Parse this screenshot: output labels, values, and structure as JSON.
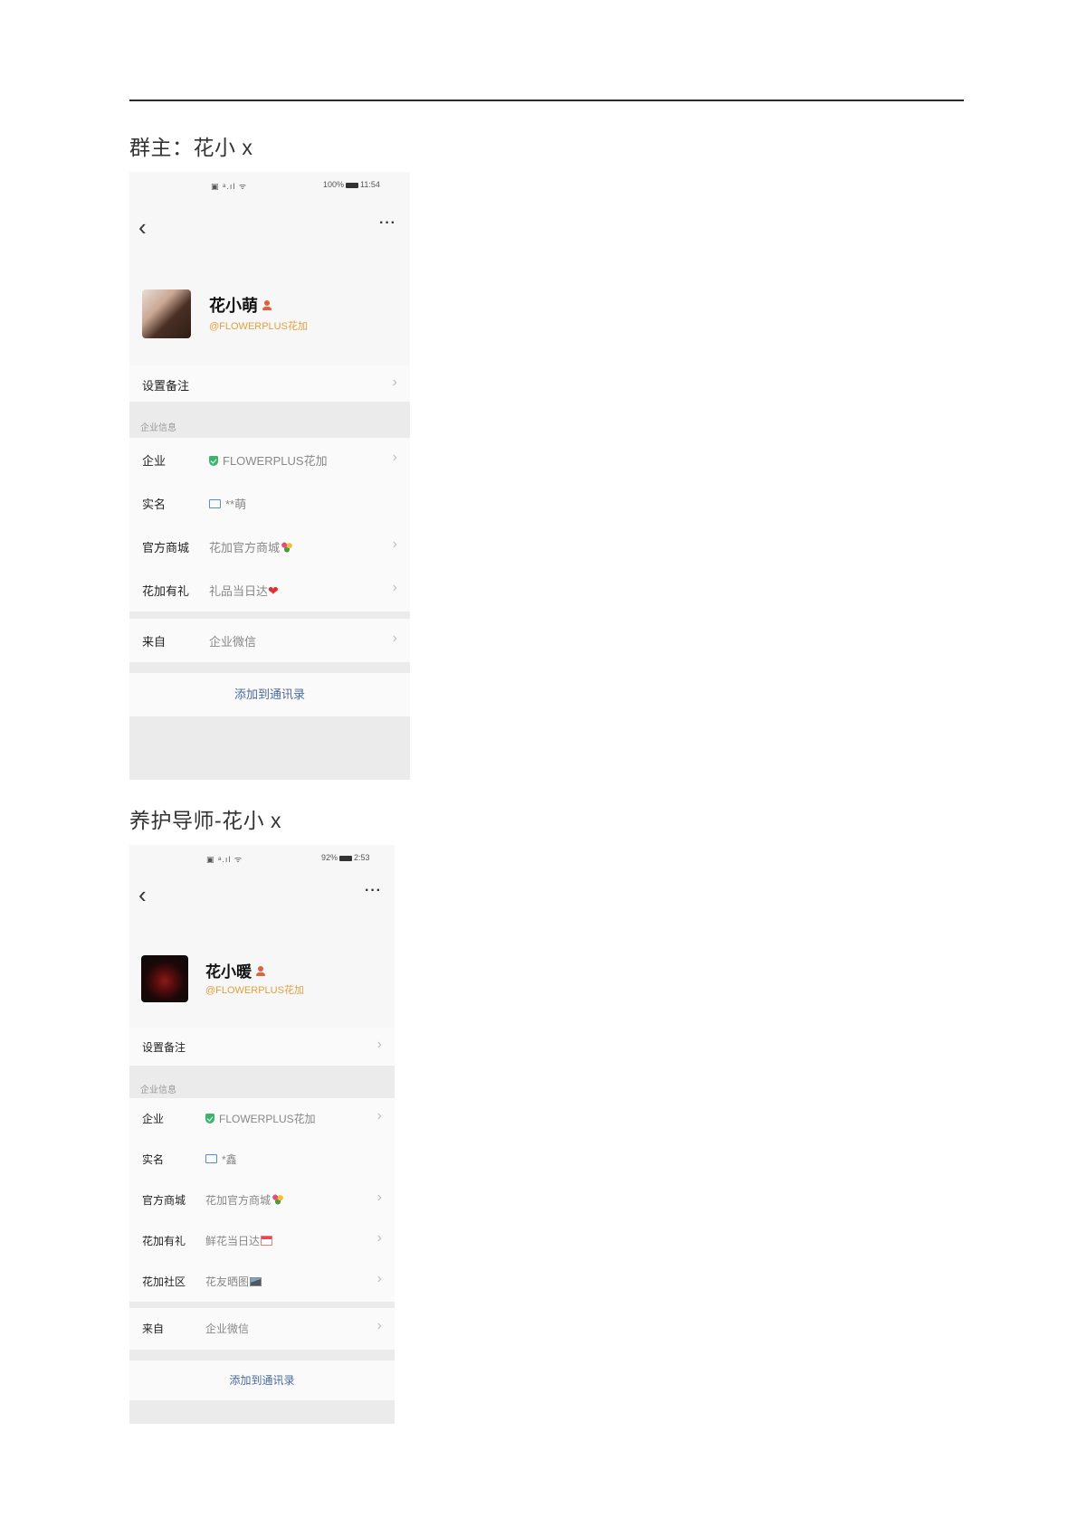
{
  "section1": {
    "title": "群主：花小 x",
    "phone": {
      "status_left": "▣ ᵃ.ıl ᯤ",
      "status_right": "100%",
      "status_time": "11:54",
      "back_icon": "chevron-left",
      "more_icon": "more-horizontal",
      "name": "花小萌",
      "handle": "@FLOWERPLUS花加",
      "set_note_label": "设置备注",
      "group_label": "企业信息",
      "rows": [
        {
          "label": "企业",
          "value": "FLOWERPLUS花加",
          "icon": "verified-shield"
        },
        {
          "label": "实名",
          "value": "**萌",
          "icon": "id-card"
        },
        {
          "label": "官方商城",
          "value": "花加官方商城",
          "icon": "bouquet-emoji"
        },
        {
          "label": "花加有礼",
          "value": "礼品当日达",
          "icon": "heart-emoji"
        }
      ],
      "from_label": "来自",
      "from_value": "企业微信",
      "add_button": "添加到通讯录"
    }
  },
  "section2": {
    "title": "养护导师-花小 x",
    "phone": {
      "status_left": "▣ ᵃ.ıl ᯤ",
      "status_right": "92%",
      "status_time": "2:53",
      "back_icon": "chevron-left",
      "more_icon": "more-horizontal",
      "name": "花小暖",
      "handle": "@FLOWERPLUS花加",
      "set_note_label": "设置备注",
      "group_label": "企业信息",
      "rows": [
        {
          "label": "企业",
          "value": "FLOWERPLUS花加",
          "icon": "verified-shield"
        },
        {
          "label": "实名",
          "value": "*鑫",
          "icon": "id-card"
        },
        {
          "label": "官方商城",
          "value": "花加官方商城",
          "icon": "bouquet-emoji"
        },
        {
          "label": "花加有礼",
          "value": "鲜花当日达",
          "icon": "calendar-emoji"
        },
        {
          "label": "花加社区",
          "value": "花友晒图",
          "icon": "photo-emoji"
        }
      ],
      "from_label": "来自",
      "from_value": "企业微信",
      "add_button": "添加到通讯录"
    }
  },
  "colors": {
    "handle": "#e0a040",
    "verified": "#3cb46e",
    "link": "#4a6a9a",
    "gap": "#ebebeb"
  }
}
